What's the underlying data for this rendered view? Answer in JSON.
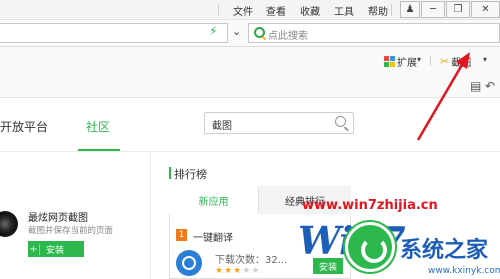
{
  "menu": {
    "items": [
      "文件",
      "查看",
      "收藏",
      "工具",
      "帮助"
    ]
  },
  "window_buttons": [
    "shirt-icon",
    "minimize-icon",
    "maximize-icon",
    "close-icon"
  ],
  "address_bar": {
    "search_placeholder": "点此搜索"
  },
  "extension_bar": {
    "extensions_label": "扩展",
    "screenshot_label": "截图"
  },
  "page": {
    "tabs": {
      "open_platform": "开放平台",
      "community": "社区"
    },
    "search_value": "截图",
    "app_card": {
      "name": "最炫网页截图",
      "description": "截图并保存当前的页面",
      "install_label": "安装"
    },
    "ranking": {
      "title": "排行榜",
      "tab_new": "新应用",
      "tab_classic": "经典排行",
      "item_rank": "1",
      "item_name": "一键翻译",
      "item_downloads": "下载次数：32...",
      "item_rating": 3,
      "item_rating_max": 5,
      "install_label": "安装"
    }
  },
  "watermark": {
    "url": "www.win7zhijia.cn",
    "logo_text": "Win7",
    "brand_cn": "系统之家",
    "bottom_url": "www.kxinyk.com"
  },
  "colors": {
    "accent_green": "#2db84d",
    "annotation_red": "#e0151e",
    "rank_orange": "#f07b1d",
    "star_gold": "#f5a623"
  }
}
